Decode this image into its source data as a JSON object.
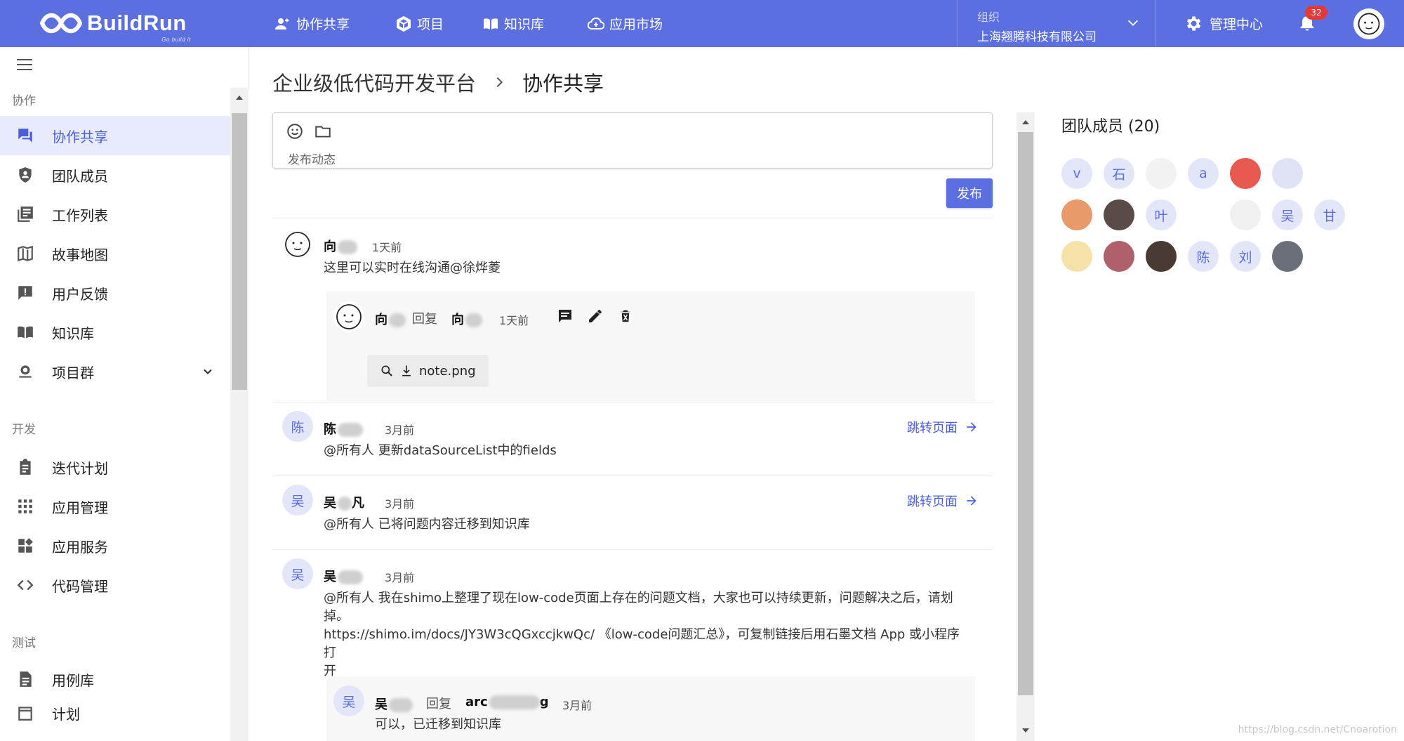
{
  "header": {
    "logo_text": "BuildRun",
    "logo_slogan": "Go build it",
    "nav": [
      {
        "label": "协作共享",
        "icon": "people-share-icon"
      },
      {
        "label": "项目",
        "icon": "cube-icon"
      },
      {
        "label": "知识库",
        "icon": "book-icon"
      },
      {
        "label": "应用市场",
        "icon": "cloud-icon"
      }
    ],
    "org_label": "组织",
    "org_name": "上海翘腾科技有限公司",
    "admin_label": "管理中心",
    "notification_count": "32"
  },
  "sidebar": {
    "sections": [
      {
        "label": "协作",
        "items": [
          {
            "label": "协作共享",
            "icon": "forum-icon",
            "active": true
          },
          {
            "label": "团队成员",
            "icon": "shield-icon"
          },
          {
            "label": "工作列表",
            "icon": "library-icon"
          },
          {
            "label": "故事地图",
            "icon": "map-icon"
          },
          {
            "label": "用户反馈",
            "icon": "feedback-icon"
          },
          {
            "label": "知识库",
            "icon": "book-icon"
          },
          {
            "label": "项目群",
            "icon": "camera-icon"
          }
        ]
      },
      {
        "label": "开发",
        "items": [
          {
            "label": "迭代计划",
            "icon": "clipboard-icon"
          },
          {
            "label": "应用管理",
            "icon": "grid-icon"
          },
          {
            "label": "应用服务",
            "icon": "widgets-icon"
          },
          {
            "label": "代码管理",
            "icon": "code-icon"
          }
        ]
      },
      {
        "label": "测试",
        "items": [
          {
            "label": "用例库",
            "icon": "document-icon"
          },
          {
            "label": "计划",
            "icon": "calendar-icon"
          }
        ]
      }
    ]
  },
  "breadcrumb": {
    "root": "企业级低代码开发平台",
    "current": "协作共享"
  },
  "composer": {
    "placeholder": "发布动态",
    "publish_label": "发布"
  },
  "posts": [
    {
      "avatar": "face",
      "name": "向",
      "time": "1天前",
      "text": "这里可以实时在线沟通@徐烨菱",
      "reply": {
        "avatar": "face",
        "from": "向",
        "word": "回复",
        "to": "向",
        "time": "1天前",
        "attachment": "note.png"
      }
    },
    {
      "avatar": "陈",
      "name": "陈",
      "time": "3月前",
      "text": "@所有人 更新dataSourceList中的fields",
      "jump_label": "跳转页面"
    },
    {
      "avatar": "吴",
      "name": "吴",
      "name_tail": "凡",
      "time": "3月前",
      "text": "@所有人 已将问题内容迁移到知识库",
      "jump_label": "跳转页面"
    },
    {
      "avatar": "吴",
      "name": "吴",
      "time": "3月前",
      "text_line1": "@所有人 我在shimo上整理了现在low-code页面上存在的问题文档，大家也可以持续更新，问题解决之后，请划",
      "text_line2": "掉。",
      "text_line3": "https://shimo.im/docs/JY3W3cQGxccjkwQc/ 《low-code问题汇总》，可复制链接后用石墨文档 App 或小程序打",
      "text_line4": "开",
      "reply": {
        "avatar": "吴",
        "from": "吴",
        "word": "回复",
        "to": "arc",
        "to_tail": "g",
        "time": "3月前",
        "text": "可以，已迁移到知识库"
      }
    }
  ],
  "team": {
    "title": "团队成员 (20)",
    "members": [
      {
        "type": "letter",
        "text": "v"
      },
      {
        "type": "letter",
        "text": "石"
      },
      {
        "type": "pic",
        "color": "#f2f2f2"
      },
      {
        "type": "letter",
        "text": "a"
      },
      {
        "type": "pic",
        "color": "#e85a4f"
      },
      {
        "type": "pic",
        "color": "#dfe3f5"
      },
      {
        "type": "pic",
        "color": "#ffffff"
      },
      {
        "type": "pic",
        "color": "#e89a6a"
      },
      {
        "type": "pic",
        "color": "#5a4a48"
      },
      {
        "type": "letter",
        "text": "叶"
      },
      {
        "type": "pic",
        "color": "#ffffff"
      },
      {
        "type": "pic",
        "color": "#f0f0f0"
      },
      {
        "type": "letter",
        "text": "吴"
      },
      {
        "type": "letter",
        "text": "甘"
      },
      {
        "type": "pic",
        "color": "#f6e2a8"
      },
      {
        "type": "pic",
        "color": "#b0606a"
      },
      {
        "type": "pic",
        "color": "#4a3a34"
      },
      {
        "type": "letter",
        "text": "陈"
      },
      {
        "type": "letter",
        "text": "刘"
      },
      {
        "type": "pic",
        "color": "#6b6f7a"
      }
    ]
  },
  "watermark": "https://blog.csdn.net/Cnoarotion",
  "colors": {
    "primary": "#5b6fe0",
    "active_bg": "#e8ebfb",
    "badge": "#e53935"
  }
}
